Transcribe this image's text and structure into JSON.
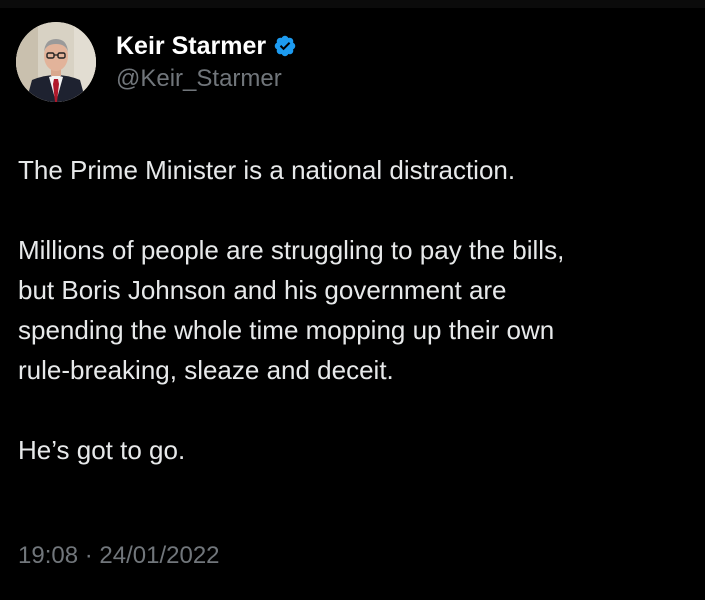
{
  "author": {
    "display_name": "Keir Starmer",
    "handle": "@Keir_Starmer",
    "verified_icon": "verified-badge-icon",
    "badge_color": "#1d9bf0"
  },
  "tweet": {
    "paragraph_1": "The Prime Minister is a national distraction.",
    "paragraph_2": "Millions of people are struggling to pay the bills,\nbut Boris Johnson and his government are\nspending the whole time mopping up their own\nrule-breaking, sleaze and deceit.",
    "paragraph_3": "He’s got to go."
  },
  "meta": {
    "time": "19:08",
    "separator": "·",
    "date": "24/01/2022"
  },
  "colors": {
    "background": "#000000",
    "text": "#e7e9ea",
    "secondary_text": "#71767b"
  }
}
